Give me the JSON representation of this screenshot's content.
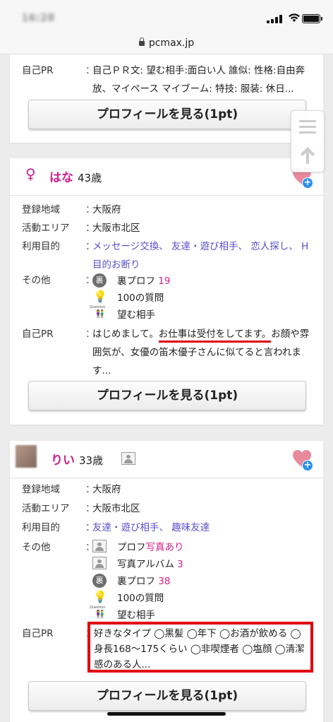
{
  "status": {
    "time": "16:28"
  },
  "browser": {
    "url": "pcmax.jp"
  },
  "float_menu": {
    "menu_icon": "hamburger-icon",
    "top_icon": "arrow-up-icon"
  },
  "card1": {
    "self_pr_label": "自己PR",
    "self_pr_text": "自己ＰＲ文: 望む相手:面白い人 誰似: 性格:自由奔放、マイペース マイブーム: 特技: 服装: 休日...",
    "button": "プロフィールを見る(1pt)"
  },
  "card2": {
    "gender_icon": "♀",
    "name": "はな",
    "age": "43歳",
    "labels": {
      "region": "登録地域",
      "area": "活動エリア",
      "purpose": "利用目的",
      "other": "その他",
      "pr": "自己PR"
    },
    "colon": "：",
    "region": "大阪府",
    "area": "大阪市北区",
    "purpose": "メッセージ交換、 友達・遊び相手、 恋人探し、 H目的お断り",
    "others": [
      {
        "icon": "ura-profile-icon",
        "icon_text": "裏",
        "label": "裏プロフ",
        "count": "19"
      },
      {
        "icon": "question-bulb-icon",
        "icon_text": "Question",
        "label": "100の質問",
        "count": ""
      },
      {
        "icon": "wish-partner-icon",
        "icon_text": "",
        "label": "望む相手",
        "count": ""
      }
    ],
    "pr_pre": "はじめまして。",
    "pr_highlight": "お仕事は受付をしてます。",
    "pr_post": "お顔や雰囲気が、女優の笛木優子さんに似てると言われます...",
    "button": "プロフィールを見る(1pt)"
  },
  "card3": {
    "name": "りい",
    "age": "33歳",
    "labels": {
      "region": "登録地域",
      "area": "活動エリア",
      "purpose": "利用目的",
      "other": "その他",
      "pr": "自己PR"
    },
    "colon": "：",
    "region": "大阪府",
    "area": "大阪市北区",
    "purpose": "友達・遊び相手、 趣味友達",
    "others": [
      {
        "icon": "profile-photo-icon",
        "label": "プロフ",
        "accent": "写真あり"
      },
      {
        "icon": "photo-album-icon",
        "label": "写真アルバム",
        "accent": "3"
      },
      {
        "icon": "ura-profile-icon",
        "icon_text": "裏",
        "label": "裏プロフ",
        "accent": "38"
      },
      {
        "icon": "question-bulb-icon",
        "icon_text": "Question",
        "label": "100の質問",
        "accent": ""
      },
      {
        "icon": "wish-partner-icon",
        "label": "望む相手",
        "accent": ""
      }
    ],
    "pr_text": "好きなタイプ ◯黒髪 ◯年下 ◯お酒が飲める ◯身長168〜175くらい ◯非喫煙者 ◯塩顔 ◯清潔感のある人...",
    "button": "プロフィールを見る(1pt)"
  },
  "colors": {
    "accent_pink": "#d0208c",
    "link_purple": "#5a4fc8",
    "highlight_red": "#e00010"
  }
}
